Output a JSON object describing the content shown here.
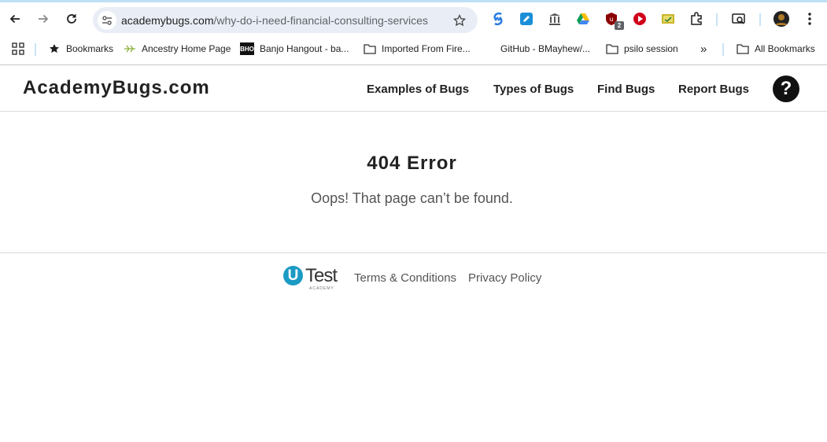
{
  "browser": {
    "url_domain": "academybugs.com",
    "url_path": "/why-do-i-need-financial-consulting-services",
    "extension_badge": "2",
    "icons": [
      "back-icon",
      "forward-icon",
      "reload-icon",
      "site-info-icon",
      "star-icon",
      "sync-icon",
      "edit-icon",
      "museum-icon",
      "drive-icon",
      "shield-icon",
      "play-icon",
      "coupon-icon",
      "extensions-icon",
      "search-tab-icon",
      "avatar-icon",
      "menu-icon"
    ]
  },
  "bookmarks": {
    "items": [
      {
        "label": "Bookmarks",
        "icon": "star-icon"
      },
      {
        "label": "Ancestry Home Page",
        "icon": "leaf-icon"
      },
      {
        "label": "Banjo Hangout - ba...",
        "icon": "bho-icon"
      },
      {
        "label": "Imported From Fire...",
        "icon": "folder-icon"
      },
      {
        "label": "GitHub - BMayhew/...",
        "icon": "github-icon"
      },
      {
        "label": "psilo session",
        "icon": "folder-icon"
      }
    ],
    "overflow": "»",
    "all_bookmarks": "All Bookmarks",
    "bho_text": "BHO"
  },
  "site": {
    "logo": "AcademyBugs.com",
    "nav": [
      "Examples of Bugs",
      "Types of Bugs",
      "Find Bugs",
      "Report Bugs"
    ],
    "help": "?"
  },
  "main": {
    "title": "404 Error",
    "message": "Oops! That page can’t be found."
  },
  "footer": {
    "logo_u": "U",
    "logo_word": "Test",
    "logo_sub": "ACADEMY",
    "links": [
      "Terms & Conditions",
      "Privacy Policy"
    ]
  },
  "colors": {
    "accent": "#1b9bc4",
    "omnibox_bg": "#e9eef6",
    "separator": "#c9e4f5"
  }
}
